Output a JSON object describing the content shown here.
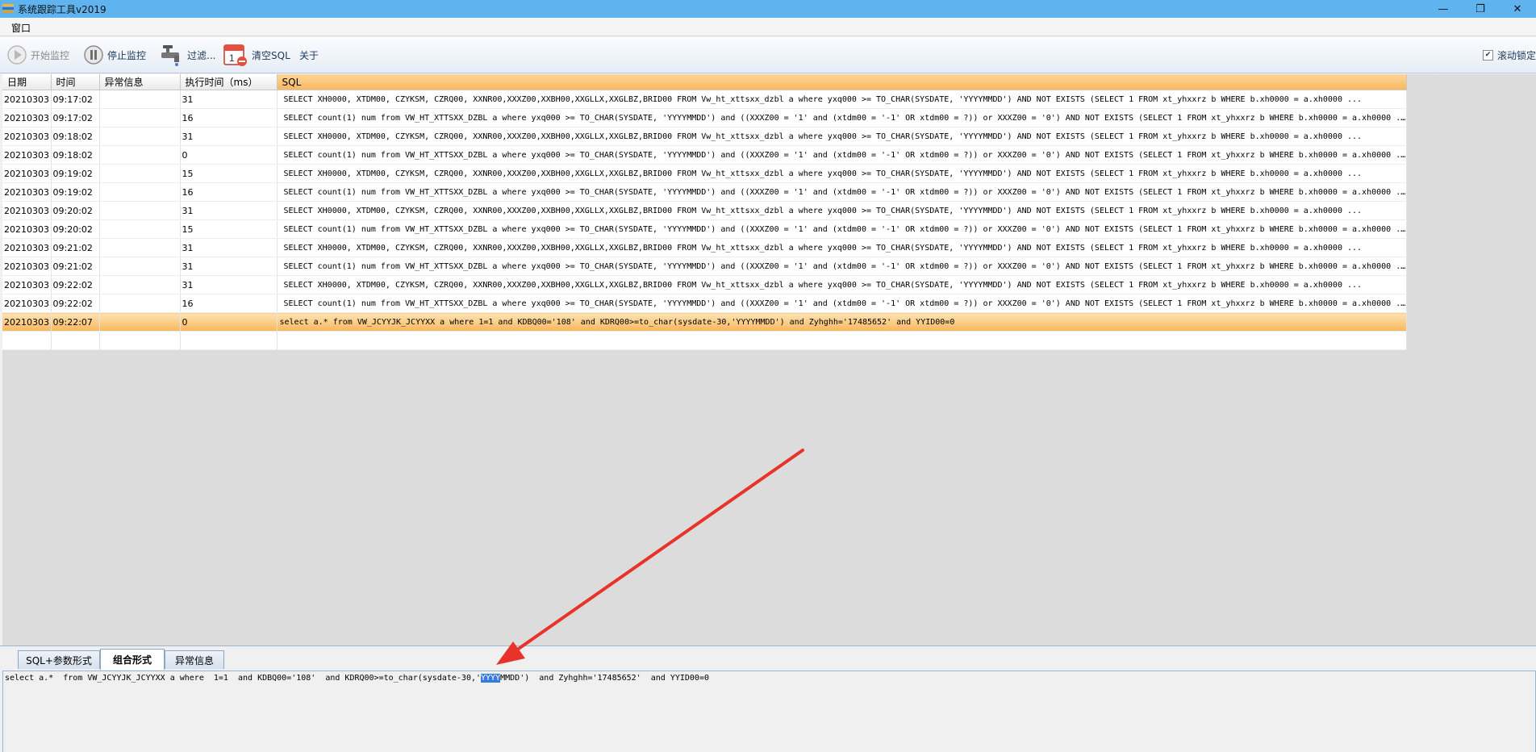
{
  "window": {
    "title": "系统跟踪工具v2019",
    "minimize_glyph": "—",
    "restore_glyph": "❐",
    "close_glyph": "✕"
  },
  "menu": {
    "items": [
      "窗口"
    ]
  },
  "toolbar": {
    "start_label": "开始监控",
    "stop_label": "停止监控",
    "filter_label": "过滤...",
    "clear_label": "清空SQL",
    "about_label": "关于",
    "auto_scroll_label": "滚动锁定",
    "auto_scroll_checked": true,
    "icons": {
      "start": "play-icon",
      "stop": "pause-icon",
      "filter": "faucet-icon",
      "clear": "calendar-clear-icon"
    }
  },
  "grid": {
    "columns": [
      "日期",
      "时间",
      "异常信息",
      "执行时间（ms）",
      "SQL"
    ],
    "rows": [
      {
        "date": "20210303",
        "time": "09:17:02",
        "error": "",
        "ms": "31",
        "sql": "SELECT XH0000, XTDM00, CZYKSM, CZRQ00, XXNR00,XXXZ00,XXBH00,XXGLLX,XXGLBZ,BRID00   FROM Vw_ht_xttsxx_dzbl a  where yxq000 >= TO_CHAR(SYSDATE, 'YYYYMMDD')       AND NOT EXISTS  (SELECT 1 FROM xt_yhxxrz b WHERE b.xh0000 = a.xh0000 ..."
      },
      {
        "date": "20210303",
        "time": "09:17:02",
        "error": "",
        "ms": "16",
        "sql": "SELECT count(1) num   from VW_HT_XTTSXX_DZBL a  where yxq000 >= TO_CHAR(SYSDATE, 'YYYYMMDD')    and ((XXXZ00 = '1' and (xtdm00 = '-1' OR xtdm00 = ?)) or XXXZ00 = '0')    AND NOT EXISTS  (SELECT 1 FROM xt_yhxxrz b WHERE b.xh0000 = a.xh0000 ..."
      },
      {
        "date": "20210303",
        "time": "09:18:02",
        "error": "",
        "ms": "31",
        "sql": "SELECT XH0000, XTDM00, CZYKSM, CZRQ00, XXNR00,XXXZ00,XXBH00,XXGLLX,XXGLBZ,BRID00   FROM Vw_ht_xttsxx_dzbl a  where yxq000 >= TO_CHAR(SYSDATE, 'YYYYMMDD')       AND NOT EXISTS  (SELECT 1 FROM xt_yhxxrz b WHERE b.xh0000 = a.xh0000 ..."
      },
      {
        "date": "20210303",
        "time": "09:18:02",
        "error": "",
        "ms": "0",
        "sql": "SELECT count(1) num   from VW_HT_XTTSXX_DZBL a  where yxq000 >= TO_CHAR(SYSDATE, 'YYYYMMDD')    and ((XXXZ00 = '1' and (xtdm00 = '-1' OR xtdm00 = ?)) or XXXZ00 = '0')    AND NOT EXISTS  (SELECT 1 FROM xt_yhxxrz b WHERE b.xh0000 = a.xh0000 ..."
      },
      {
        "date": "20210303",
        "time": "09:19:02",
        "error": "",
        "ms": "15",
        "sql": "SELECT XH0000, XTDM00, CZYKSM, CZRQ00, XXNR00,XXXZ00,XXBH00,XXGLLX,XXGLBZ,BRID00   FROM Vw_ht_xttsxx_dzbl a  where yxq000 >= TO_CHAR(SYSDATE, 'YYYYMMDD')       AND NOT EXISTS  (SELECT 1 FROM xt_yhxxrz b WHERE b.xh0000 = a.xh0000 ..."
      },
      {
        "date": "20210303",
        "time": "09:19:02",
        "error": "",
        "ms": "16",
        "sql": "SELECT count(1) num   from VW_HT_XTTSXX_DZBL a  where yxq000 >= TO_CHAR(SYSDATE, 'YYYYMMDD')    and ((XXXZ00 = '1' and (xtdm00 = '-1' OR xtdm00 = ?)) or XXXZ00 = '0')    AND NOT EXISTS  (SELECT 1 FROM xt_yhxxrz b WHERE b.xh0000 = a.xh0000 ..."
      },
      {
        "date": "20210303",
        "time": "09:20:02",
        "error": "",
        "ms": "31",
        "sql": "SELECT XH0000, XTDM00, CZYKSM, CZRQ00, XXNR00,XXXZ00,XXBH00,XXGLLX,XXGLBZ,BRID00   FROM Vw_ht_xttsxx_dzbl a  where yxq000 >= TO_CHAR(SYSDATE, 'YYYYMMDD')       AND NOT EXISTS  (SELECT 1 FROM xt_yhxxrz b WHERE b.xh0000 = a.xh0000 ..."
      },
      {
        "date": "20210303",
        "time": "09:20:02",
        "error": "",
        "ms": "15",
        "sql": "SELECT count(1) num   from VW_HT_XTTSXX_DZBL a  where yxq000 >= TO_CHAR(SYSDATE, 'YYYYMMDD')    and ((XXXZ00 = '1' and (xtdm00 = '-1' OR xtdm00 = ?)) or XXXZ00 = '0')    AND NOT EXISTS  (SELECT 1 FROM xt_yhxxrz b WHERE b.xh0000 = a.xh0000 ..."
      },
      {
        "date": "20210303",
        "time": "09:21:02",
        "error": "",
        "ms": "31",
        "sql": "SELECT XH0000, XTDM00, CZYKSM, CZRQ00, XXNR00,XXXZ00,XXBH00,XXGLLX,XXGLBZ,BRID00   FROM Vw_ht_xttsxx_dzbl a  where yxq000 >= TO_CHAR(SYSDATE, 'YYYYMMDD')       AND NOT EXISTS  (SELECT 1 FROM xt_yhxxrz b WHERE b.xh0000 = a.xh0000 ..."
      },
      {
        "date": "20210303",
        "time": "09:21:02",
        "error": "",
        "ms": "31",
        "sql": "SELECT count(1) num   from VW_HT_XTTSXX_DZBL a  where yxq000 >= TO_CHAR(SYSDATE, 'YYYYMMDD')    and ((XXXZ00 = '1' and (xtdm00 = '-1' OR xtdm00 = ?)) or XXXZ00 = '0')    AND NOT EXISTS  (SELECT 1 FROM xt_yhxxrz b WHERE b.xh0000 = a.xh0000 ..."
      },
      {
        "date": "20210303",
        "time": "09:22:02",
        "error": "",
        "ms": "31",
        "sql": "SELECT XH0000, XTDM00, CZYKSM, CZRQ00, XXNR00,XXXZ00,XXBH00,XXGLLX,XXGLBZ,BRID00   FROM Vw_ht_xttsxx_dzbl a  where yxq000 >= TO_CHAR(SYSDATE, 'YYYYMMDD')       AND NOT EXISTS  (SELECT 1 FROM xt_yhxxrz b WHERE b.xh0000 = a.xh0000 ..."
      },
      {
        "date": "20210303",
        "time": "09:22:02",
        "error": "",
        "ms": "16",
        "sql": "SELECT count(1) num   from VW_HT_XTTSXX_DZBL a  where yxq000 >= TO_CHAR(SYSDATE, 'YYYYMMDD')    and ((XXXZ00 = '1' and (xtdm00 = '-1' OR xtdm00 = ?)) or XXXZ00 = '0')    AND NOT EXISTS  (SELECT 1 FROM xt_yhxxrz b WHERE b.xh0000 = a.xh0000 ..."
      },
      {
        "date": "20210303",
        "time": "09:22:07",
        "error": "",
        "ms": "0",
        "sql": "select a.*  from VW_JCYYJK_JCYYXX a where  1=1  and KDBQ00='108'  and KDRQ00>=to_char(sysdate-30,'YYYYMMDD')  and Zyhghh='17485652'  and YYID00=0",
        "selected": true
      }
    ]
  },
  "bottom_tabs": {
    "items": [
      "SQL+参数形式",
      "组合形式",
      "异常信息"
    ],
    "active_index": 1
  },
  "bottom_sql": {
    "before": "select a.*  from VW_JCYYJK_JCYYXX a where  1=1  and KDBQ00='108'  and KDRQ00>=to_char(sysdate-30,'",
    "highlight": "YYYY",
    "after": "MMDD')  and Zyhghh='17485652'  and YYID00=0"
  },
  "colors": {
    "titlebar": "#5fb4ef",
    "selected_row": "#f8b75b",
    "arrow": "#e8332a",
    "text_highlight": "#3a7ad8"
  }
}
